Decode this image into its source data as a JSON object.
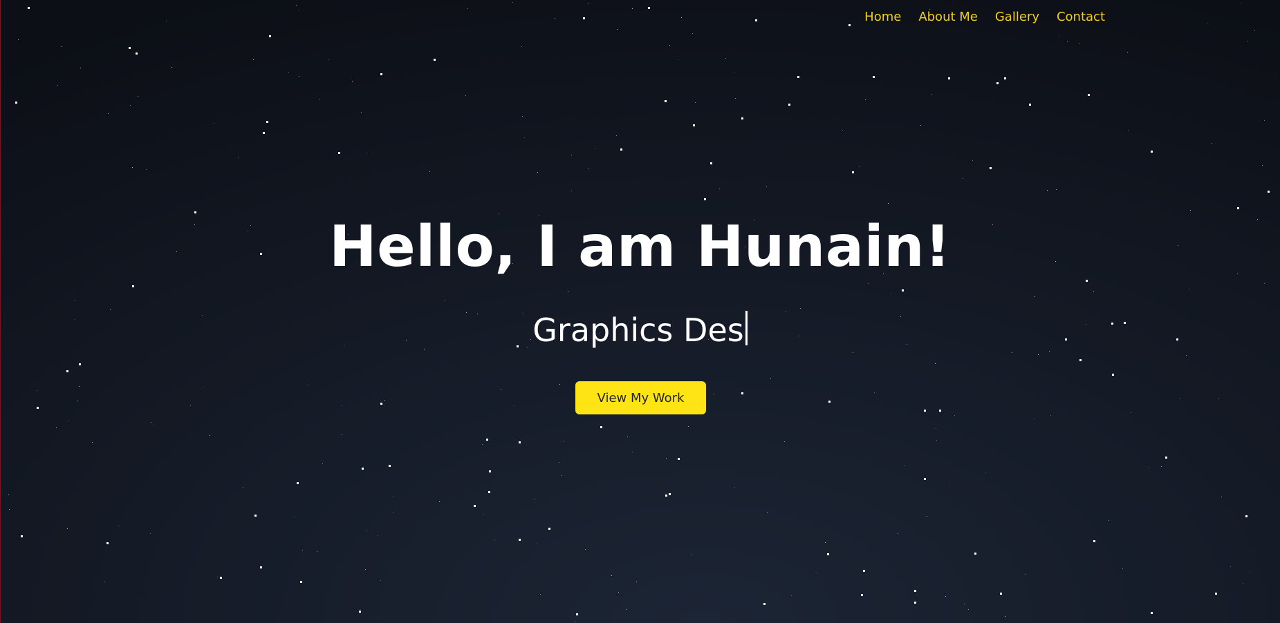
{
  "nav": {
    "links": [
      {
        "label": "Home"
      },
      {
        "label": "About Me"
      },
      {
        "label": "Gallery"
      },
      {
        "label": "Contact"
      }
    ]
  },
  "hero": {
    "headline": "Hello, I am Hunain!",
    "typed_text": "Graphics Des",
    "cta_label": "View My Work"
  },
  "colors": {
    "accent": "#f2cf1b",
    "button": "#ffe415",
    "background": "#0c0f16",
    "text": "#ffffff"
  }
}
